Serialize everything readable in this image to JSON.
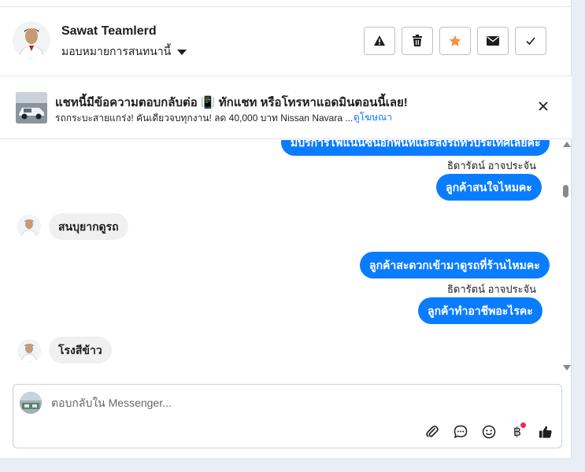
{
  "header": {
    "name": "Sawat Teamlerd",
    "assign_label": "มอบหมายการสนทนานี้",
    "actions": [
      {
        "icon": "warning-icon"
      },
      {
        "icon": "trash-icon"
      },
      {
        "icon": "star-icon",
        "color": "#f7923a"
      },
      {
        "icon": "mail-icon"
      },
      {
        "icon": "check-icon"
      }
    ]
  },
  "ad_banner": {
    "title": "แชทนี้มีข้อความตอบกลับต่อ 📳 ทักแชท หรือโทรหาแอดมินตอนนี้เลย!",
    "subtitle": "รถกระบะสายแกร่ง! คันเดียวจบทุกงาน! ลด 40,000 บาท Nissan Navara ...",
    "link": "ดูโฆษณา"
  },
  "messages": {
    "partial_out": "มีบริการไฟแนนซ์นอกพื้นที่และส่งรถทั่วประเทศเลยค่ะ",
    "sender_1": "ธิดารัตน์ อาจประจัน",
    "out_1": "ลูกค้าสนใจไหมคะ",
    "in_1": "สนบุยากดูรถ",
    "out_2": "ลูกค้าสะดวกเข้ามาดูรถที่ร้านไหมคะ",
    "sender_2": "ธิดารัตน์ อาจประจัน",
    "out_3": "ลูกค้าทำอาชีพอะไรคะ",
    "in_2": "โรงสีข้าว"
  },
  "composer": {
    "placeholder": "ตอบกลับใน Messenger...",
    "baht_symbol": "฿",
    "tools": [
      "paperclip-icon",
      "chat-bubble-icon",
      "smiley-icon",
      "baht-icon",
      "thumbs-up-icon"
    ]
  },
  "colors": {
    "accent": "#0a7cff",
    "link": "#1877f2",
    "star": "#f7923a",
    "badge": "#f02849"
  }
}
